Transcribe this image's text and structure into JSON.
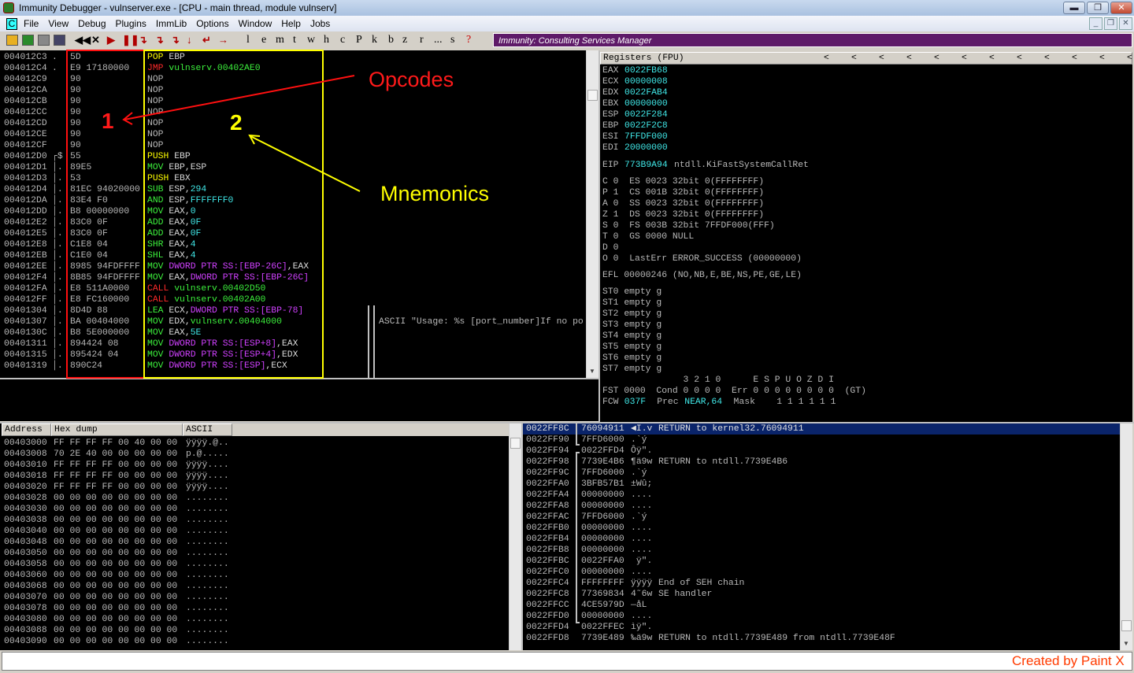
{
  "window": {
    "title": "Immunity Debugger - vulnserver.exe - [CPU - main thread, module vulnserv]",
    "buttons": [
      "minimize",
      "restore",
      "close"
    ]
  },
  "menu": [
    "File",
    "View",
    "Debug",
    "Plugins",
    "ImmLib",
    "Options",
    "Window",
    "Help",
    "Jobs"
  ],
  "toolbar": {
    "icons": [
      "open-icon",
      "restart-icon",
      "close-doc-icon",
      "log-icon"
    ],
    "controls": [
      "◀◀",
      "✕",
      "▶",
      "❚❚",
      "↴",
      "↴",
      "↴",
      "↓",
      "↵",
      "→"
    ],
    "letters": [
      "l",
      "e",
      "m",
      "t",
      "w",
      "h",
      "c",
      "P",
      "k",
      "b",
      "z",
      "r",
      "...",
      "s",
      "?"
    ],
    "banner": "Immunity: Consulting Services Manager"
  },
  "colors": {
    "gray": "#b8b8b8",
    "yellow": "#ffff00",
    "red": "#ff2a2a",
    "green": "#3cf03c",
    "cyan": "#40e8e8",
    "magenta": "#d040ff",
    "white": "#d8d8d8",
    "selection": "#0a246a",
    "banner": "#5e1a68"
  },
  "disasm": [
    {
      "addr": "004012C3",
      "mark": ".",
      "hex": "5D",
      "mn": "POP",
      "mc": "yellow",
      "ops": [
        [
          "EBP",
          "white"
        ]
      ]
    },
    {
      "addr": "004012C4",
      "mark": ".",
      "hex": "E9 17180000",
      "mn": "JMP",
      "mc": "red",
      "ops": [
        [
          "vulnserv.00402AE0",
          "green"
        ]
      ]
    },
    {
      "addr": "004012C9",
      "mark": "",
      "hex": "90",
      "mn": "NOP",
      "mc": "gray",
      "ops": []
    },
    {
      "addr": "004012CA",
      "mark": "",
      "hex": "90",
      "mn": "NOP",
      "mc": "gray",
      "ops": []
    },
    {
      "addr": "004012CB",
      "mark": "",
      "hex": "90",
      "mn": "NOP",
      "mc": "gray",
      "ops": []
    },
    {
      "addr": "004012CC",
      "mark": "",
      "hex": "90",
      "mn": "NOP",
      "mc": "gray",
      "ops": []
    },
    {
      "addr": "004012CD",
      "mark": "",
      "hex": "90",
      "mn": "NOP",
      "mc": "gray",
      "ops": []
    },
    {
      "addr": "004012CE",
      "mark": "",
      "hex": "90",
      "mn": "NOP",
      "mc": "gray",
      "ops": []
    },
    {
      "addr": "004012CF",
      "mark": "",
      "hex": "90",
      "mn": "NOP",
      "mc": "gray",
      "ops": []
    },
    {
      "addr": "004012D0",
      "mark": "┌$",
      "hex": "55",
      "mn": "PUSH",
      "mc": "yellow",
      "ops": [
        [
          "EBP",
          "white"
        ]
      ]
    },
    {
      "addr": "004012D1",
      "mark": "│.",
      "hex": "89E5",
      "mn": "MOV",
      "mc": "green",
      "ops": [
        [
          "EBP,ESP",
          "white"
        ]
      ]
    },
    {
      "addr": "004012D3",
      "mark": "│.",
      "hex": "53",
      "mn": "PUSH",
      "mc": "yellow",
      "ops": [
        [
          "EBX",
          "white"
        ]
      ]
    },
    {
      "addr": "004012D4",
      "mark": "│.",
      "hex": "81EC 94020000",
      "mn": "SUB",
      "mc": "green",
      "ops": [
        [
          "ESP,",
          "white"
        ],
        [
          "294",
          "cyan"
        ]
      ]
    },
    {
      "addr": "004012DA",
      "mark": "│.",
      "hex": "83E4 F0",
      "mn": "AND",
      "mc": "green",
      "ops": [
        [
          "ESP,",
          "white"
        ],
        [
          "FFFFFFF0",
          "cyan"
        ]
      ]
    },
    {
      "addr": "004012DD",
      "mark": "│.",
      "hex": "B8 00000000",
      "mn": "MOV",
      "mc": "green",
      "ops": [
        [
          "EAX,",
          "white"
        ],
        [
          "0",
          "cyan"
        ]
      ]
    },
    {
      "addr": "004012E2",
      "mark": "│.",
      "hex": "83C0 0F",
      "mn": "ADD",
      "mc": "green",
      "ops": [
        [
          "EAX,",
          "white"
        ],
        [
          "0F",
          "cyan"
        ]
      ]
    },
    {
      "addr": "004012E5",
      "mark": "│.",
      "hex": "83C0 0F",
      "mn": "ADD",
      "mc": "green",
      "ops": [
        [
          "EAX,",
          "white"
        ],
        [
          "0F",
          "cyan"
        ]
      ]
    },
    {
      "addr": "004012E8",
      "mark": "│.",
      "hex": "C1E8 04",
      "mn": "SHR",
      "mc": "green",
      "ops": [
        [
          "EAX,",
          "white"
        ],
        [
          "4",
          "cyan"
        ]
      ]
    },
    {
      "addr": "004012EB",
      "mark": "│.",
      "hex": "C1E0 04",
      "mn": "SHL",
      "mc": "green",
      "ops": [
        [
          "EAX,",
          "white"
        ],
        [
          "4",
          "cyan"
        ]
      ]
    },
    {
      "addr": "004012EE",
      "mark": "│.",
      "hex": "8985 94FDFFFF",
      "mn": "MOV",
      "mc": "green",
      "ops": [
        [
          "DWORD PTR SS:[EBP-26C]",
          "magenta"
        ],
        [
          ",EAX",
          "white"
        ]
      ]
    },
    {
      "addr": "004012F4",
      "mark": "│.",
      "hex": "8B85 94FDFFFF",
      "mn": "MOV",
      "mc": "green",
      "ops": [
        [
          "EAX,",
          "white"
        ],
        [
          "DWORD PTR SS:[EBP-26C]",
          "magenta"
        ]
      ]
    },
    {
      "addr": "004012FA",
      "mark": "│.",
      "hex": "E8 511A0000",
      "mn": "CALL",
      "mc": "red",
      "ops": [
        [
          "vulnserv.00402D50",
          "green"
        ]
      ]
    },
    {
      "addr": "004012FF",
      "mark": "│.",
      "hex": "E8 FC160000",
      "mn": "CALL",
      "mc": "red",
      "ops": [
        [
          "vulnserv.00402A00",
          "green"
        ]
      ]
    },
    {
      "addr": "00401304",
      "mark": "│.",
      "hex": "8D4D 88",
      "mn": "LEA",
      "mc": "green",
      "ops": [
        [
          "ECX,",
          "white"
        ],
        [
          "DWORD PTR SS:[EBP-78]",
          "magenta"
        ]
      ]
    },
    {
      "addr": "00401307",
      "mark": "│.",
      "hex": "BA 00404000",
      "mn": "MOV",
      "mc": "green",
      "ops": [
        [
          "EDX,",
          "white"
        ],
        [
          "vulnserv.00404000",
          "green"
        ]
      ]
    },
    {
      "addr": "0040130C",
      "mark": "│.",
      "hex": "B8 5E000000",
      "mn": "MOV",
      "mc": "green",
      "ops": [
        [
          "EAX,",
          "white"
        ],
        [
          "5E",
          "cyan"
        ]
      ]
    },
    {
      "addr": "00401311",
      "mark": "│.",
      "hex": "894424 08",
      "mn": "MOV",
      "mc": "green",
      "ops": [
        [
          "DWORD PTR SS:[ESP+8]",
          "magenta"
        ],
        [
          ",EAX",
          "white"
        ]
      ]
    },
    {
      "addr": "00401315",
      "mark": "│.",
      "hex": "895424 04",
      "mn": "MOV",
      "mc": "green",
      "ops": [
        [
          "DWORD PTR SS:[ESP+4]",
          "magenta"
        ],
        [
          ",EDX",
          "white"
        ]
      ]
    },
    {
      "addr": "00401319",
      "mark": "│.",
      "hex": "890C24",
      "mn": "MOV",
      "mc": "green",
      "ops": [
        [
          "DWORD PTR SS:[ESP]",
          "magenta"
        ],
        [
          ",ECX",
          "white"
        ]
      ]
    }
  ],
  "disasm_comment": "ASCII \"Usage: %s [port_number]If no po",
  "annotations": {
    "opcodes": "Opcodes",
    "mnemonics": "Mnemonics",
    "one": "1",
    "two": "2"
  },
  "registers": {
    "header": "Registers (FPU)",
    "arrows": "<",
    "gp": [
      [
        "EAX",
        "0022FB68"
      ],
      [
        "ECX",
        "00000008"
      ],
      [
        "EDX",
        "0022FAB4"
      ],
      [
        "EBX",
        "00000000"
      ],
      [
        "ESP",
        "0022F284"
      ],
      [
        "EBP",
        "0022F2C8"
      ],
      [
        "ESI",
        "7FFDF000"
      ],
      [
        "EDI",
        "20000000"
      ]
    ],
    "eip": [
      "EIP",
      "773B9A94",
      "ntdll.KiFastSystemCallRet"
    ],
    "flags": [
      "C 0  ES 0023 32bit 0(FFFFFFFF)",
      "P 1  CS 001B 32bit 0(FFFFFFFF)",
      "A 0  SS 0023 32bit 0(FFFFFFFF)",
      "Z 1  DS 0023 32bit 0(FFFFFFFF)",
      "S 0  FS 003B 32bit 7FFDF000(FFF)",
      "T 0  GS 0000 NULL",
      "D 0",
      "O 0  LastErr ERROR_SUCCESS (00000000)"
    ],
    "efl": "EFL 00000246 (NO,NB,E,BE,NS,PE,GE,LE)",
    "fpu": [
      "ST0 empty g",
      "ST1 empty g",
      "ST2 empty g",
      "ST3 empty g",
      "ST4 empty g",
      "ST5 empty g",
      "ST6 empty g",
      "ST7 empty g"
    ],
    "fst_header": "               3 2 1 0      E S P U O Z D I",
    "fst": "FST 0000  Cond 0 0 0 0  Err 0 0 0 0 0 0 0 0  (GT)",
    "fcw": [
      "FCW ",
      "037F",
      "  Prec ",
      "NEAR,64",
      "  Mask    1 1 1 1 1 1"
    ]
  },
  "dump": {
    "headers": [
      "Address",
      "Hex dump",
      "ASCII"
    ],
    "rows": [
      [
        "00403000",
        "FF FF FF FF 00 40 00 00",
        "ÿÿÿÿ.@.."
      ],
      [
        "00403008",
        "70 2E 40 00 00 00 00 00",
        "p.@....."
      ],
      [
        "00403010",
        "FF FF FF FF 00 00 00 00",
        "ÿÿÿÿ...."
      ],
      [
        "00403018",
        "FF FF FF FF 00 00 00 00",
        "ÿÿÿÿ...."
      ],
      [
        "00403020",
        "FF FF FF FF 00 00 00 00",
        "ÿÿÿÿ...."
      ],
      [
        "00403028",
        "00 00 00 00 00 00 00 00",
        "........"
      ],
      [
        "00403030",
        "00 00 00 00 00 00 00 00",
        "........"
      ],
      [
        "00403038",
        "00 00 00 00 00 00 00 00",
        "........"
      ],
      [
        "00403040",
        "00 00 00 00 00 00 00 00",
        "........"
      ],
      [
        "00403048",
        "00 00 00 00 00 00 00 00",
        "........"
      ],
      [
        "00403050",
        "00 00 00 00 00 00 00 00",
        "........"
      ],
      [
        "00403058",
        "00 00 00 00 00 00 00 00",
        "........"
      ],
      [
        "00403060",
        "00 00 00 00 00 00 00 00",
        "........"
      ],
      [
        "00403068",
        "00 00 00 00 00 00 00 00",
        "........"
      ],
      [
        "00403070",
        "00 00 00 00 00 00 00 00",
        "........"
      ],
      [
        "00403078",
        "00 00 00 00 00 00 00 00",
        "........"
      ],
      [
        "00403080",
        "00 00 00 00 00 00 00 00",
        "........"
      ],
      [
        "00403088",
        "00 00 00 00 00 00 00 00",
        "........"
      ],
      [
        "00403090",
        "00 00 00 00 00 00 00 00",
        "........"
      ]
    ]
  },
  "stack": [
    [
      "0022FF8C",
      "76094911",
      "◀I.v",
      "RETURN to kernel32.76094911"
    ],
    [
      "0022FF90",
      "7FFD6000",
      ".`ý",
      ""
    ],
    [
      "0022FF94",
      "0022FFD4",
      "Ôÿ\".",
      ""
    ],
    [
      "0022FF98",
      "7739E4B6",
      "¶ä9w",
      "RETURN to ntdll.7739E4B6"
    ],
    [
      "0022FF9C",
      "7FFD6000",
      ".`ý",
      ""
    ],
    [
      "0022FFA0",
      "3BFB57B1",
      "±Wû;",
      ""
    ],
    [
      "0022FFA4",
      "00000000",
      "....",
      ""
    ],
    [
      "0022FFA8",
      "00000000",
      "....",
      ""
    ],
    [
      "0022FFAC",
      "7FFD6000",
      ".`ý",
      ""
    ],
    [
      "0022FFB0",
      "00000000",
      "....",
      ""
    ],
    [
      "0022FFB4",
      "00000000",
      "....",
      ""
    ],
    [
      "0022FFB8",
      "00000000",
      "....",
      ""
    ],
    [
      "0022FFBC",
      "0022FFA0",
      " ÿ\".",
      ""
    ],
    [
      "0022FFC0",
      "00000000",
      "....",
      ""
    ],
    [
      "0022FFC4",
      "FFFFFFFF",
      "ÿÿÿÿ",
      "End of SEH chain"
    ],
    [
      "0022FFC8",
      "77369834",
      "4˜6w",
      "SE handler"
    ],
    [
      "0022FFCC",
      "4CE5979D",
      "—åL",
      ""
    ],
    [
      "0022FFD0",
      "00000000",
      "....",
      ""
    ],
    [
      "0022FFD4",
      "0022FFEC",
      "ìÿ\".",
      ""
    ],
    [
      "0022FFD8",
      "7739E489",
      "‰ä9w",
      "RETURN to ntdll.7739E489 from ntdll.7739E48F"
    ]
  ],
  "watermark": "Created by Paint X"
}
